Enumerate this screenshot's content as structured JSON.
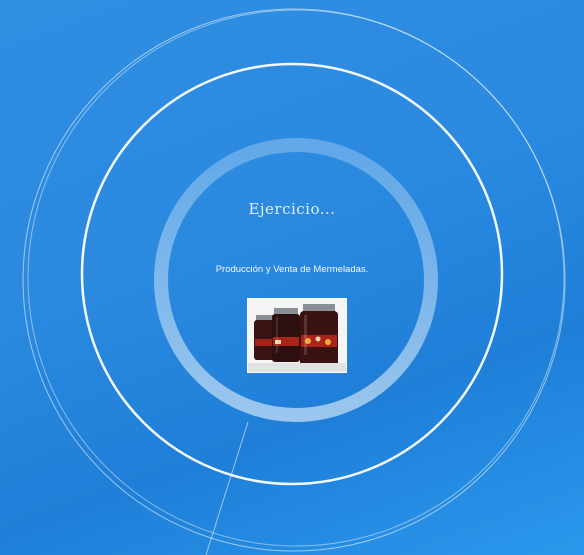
{
  "slide": {
    "title": "Ejercicio...",
    "subtitle": "Producción y Venta de Mermeladas."
  },
  "image": {
    "icon": "jam-jars-photo",
    "colors": {
      "jar": "#3a1414",
      "fruit": "#c0281c",
      "lid": "#8a8f96",
      "label": "#e8d8a8"
    }
  },
  "colors": {
    "background_top": "#2f8ee2",
    "background_bottom": "#2a98ec",
    "ring": "#ffffff"
  }
}
